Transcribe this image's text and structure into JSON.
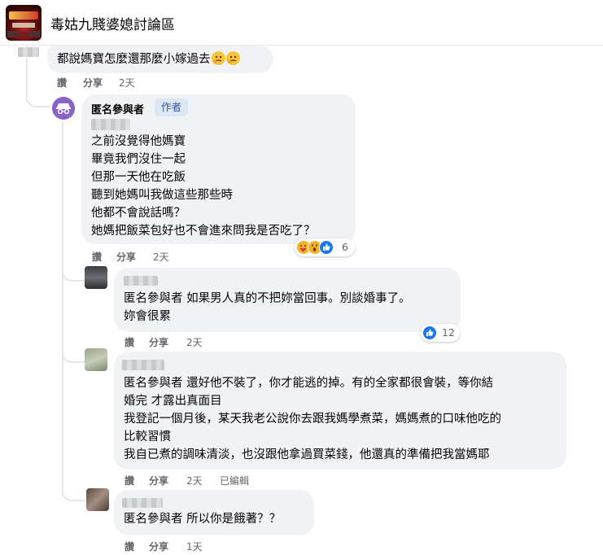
{
  "header": {
    "group_name": "毒姑九賤婆媳討論區"
  },
  "labels": {
    "like": "讚",
    "reply": "分享",
    "author": "作者",
    "edited": "已編輯"
  },
  "comments": [
    {
      "text": "都說媽寶怎麼還那麼小嫁過去",
      "emojis": [
        "thinking-face",
        "thinking-face"
      ],
      "time": "2天"
    },
    {
      "name": "匿名參與者",
      "badge": "作者",
      "lines": [
        "之前沒覺得他媽寶",
        "畢竟我們沒住一起",
        "但那一天他在吃飯",
        "聽到她媽叫我做這些那些時",
        "他都不會說話嗎？",
        "她媽把飯菜包好也不會進來問我是否吃了？"
      ],
      "reactions": {
        "icons": [
          "care",
          "wow",
          "like"
        ],
        "count": "6"
      },
      "time": "2天"
    },
    {
      "lines": [
        "匿名參與者  如果男人真的不把妳當回事。別談婚事了。",
        "妳會很累"
      ],
      "reactions": {
        "icons": [
          "like"
        ],
        "count": "12"
      },
      "time": "2天"
    },
    {
      "lines": [
        "匿名參與者  還好他不裝了，你才能逃的掉。有的全家都很會裝，等你結",
        "婚完 才露出真面目",
        "我登記一個月後，某天我老公說你去跟我媽學煮菜，媽媽煮的口味他吃的",
        "比較習慣",
        "我自已煮的調味清淡，也沒跟他拿過買菜錢，他還真的準備把我當媽耶"
      ],
      "time": "2天",
      "edited": "已編輯"
    },
    {
      "lines": [
        "匿名參與者  所以你是餓著？？"
      ],
      "time": "1天"
    }
  ],
  "colors": {
    "bubble": "#f0f2f5",
    "meta_text": "#65676b",
    "like_blue": "#1877f2",
    "author_badge_bg": "#dbe7f2",
    "author_badge_text": "#385898"
  }
}
